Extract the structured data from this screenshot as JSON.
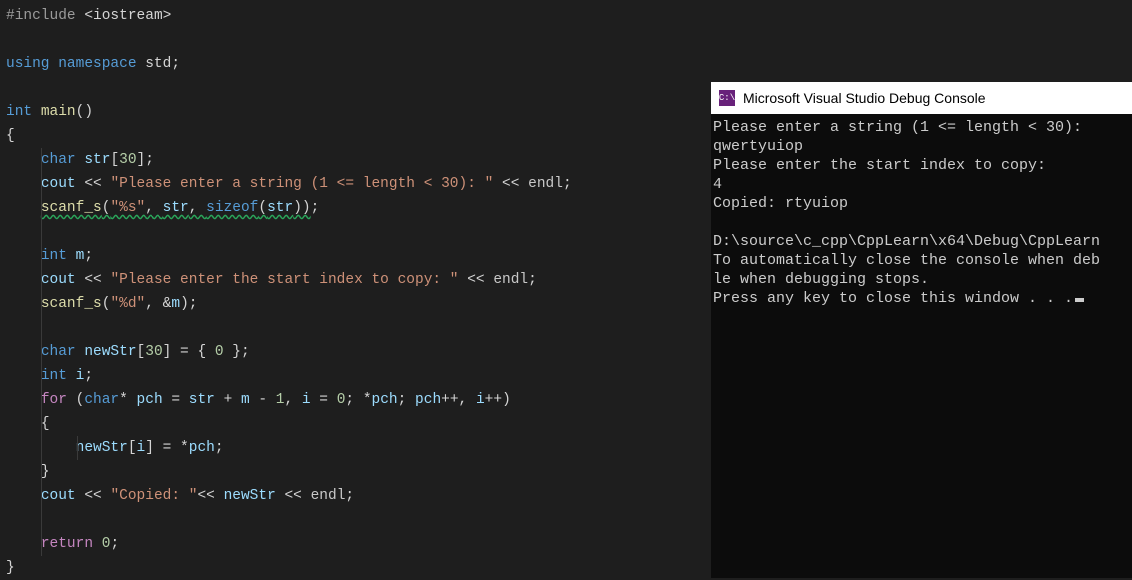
{
  "editor": {
    "lines": {
      "l1_include": "#include ",
      "l1_angleL": "<",
      "l1_hdr": "iostream",
      "l1_angleR": ">",
      "l3_using": "using ",
      "l3_namespace": "namespace ",
      "l3_std": "std",
      "l3_semi": ";",
      "l5_int": "int ",
      "l5_main": "main",
      "l5_parens": "()",
      "l6_brace": "{",
      "l7_char": "char ",
      "l7_str": "str",
      "l7_dim": "[",
      "l7_30": "30",
      "l7_end": "];",
      "l8_cout": "cout ",
      "l8_ins": "<< ",
      "l8_str": "\"Please enter a string (1 <= length < 30): \"",
      "l8_ins2": " << ",
      "l8_endl": "endl",
      "l8_semi": ";",
      "l9_scanf": "scanf_s",
      "l9_open": "(",
      "l9_fmt": "\"%s\"",
      "l9_c1": ", ",
      "l9_arg1": "str",
      "l9_c2": ", ",
      "l9_sizeof": "sizeof",
      "l9_so": "(",
      "l9_sa": "str",
      "l9_sc": "))",
      "l9_semi": ";",
      "l11_int": "int ",
      "l11_m": "m",
      "l11_semi": ";",
      "l12_cout": "cout ",
      "l12_ins": "<< ",
      "l12_str": "\"Please enter the start index to copy: \"",
      "l12_ins2": " << ",
      "l12_endl": "endl",
      "l12_semi": ";",
      "l13_scanf": "scanf_s",
      "l13_open": "(",
      "l13_fmt": "\"%d\"",
      "l13_c1": ", &",
      "l13_m": "m",
      "l13_close": ")",
      "l13_semi": ";",
      "l15_char": "char ",
      "l15_ns": "newStr",
      "l15_dim": "[",
      "l15_30": "30",
      "l15_cb": "] = { ",
      "l15_0": "0",
      "l15_ce": " };",
      "l16_int": "int ",
      "l16_i": "i",
      "l16_semi": ";",
      "l17_for": "for ",
      "l17_open": "(",
      "l17_char": "char",
      "l17_star": "* ",
      "l17_pch": "pch",
      "l17_eq": " = ",
      "l17_str": "str",
      "l17_plus": " + ",
      "l17_m": "m",
      "l17_m1": " - ",
      "l17_1": "1",
      "l17_c1": ", ",
      "l17_i": "i",
      "l17_eq0": " = ",
      "l17_0": "0",
      "l17_sc1": "; *",
      "l17_pch2": "pch",
      "l17_sc2": "; ",
      "l17_pch3": "pch",
      "l17_pp": "++, ",
      "l17_i2": "i",
      "l17_pp2": "++)",
      "l18_brace": "{",
      "l19_ns": "newStr",
      "l19_ob": "[",
      "l19_i": "i",
      "l19_cb": "] = *",
      "l19_pch": "pch",
      "l19_semi": ";",
      "l20_brace": "}",
      "l21_cout": "cout ",
      "l21_ins": "<< ",
      "l21_str": "\"Copied: \"",
      "l21_ins2": "<< ",
      "l21_ns": "newStr",
      "l21_ins3": " << ",
      "l21_endl": "endl",
      "l21_semi": ";",
      "l23_return": "return ",
      "l23_0": "0",
      "l23_semi": ";",
      "l24_brace": "}"
    }
  },
  "console": {
    "title": "Microsoft Visual Studio Debug Console",
    "icon_text": "C:\\",
    "lines": [
      "Please enter a string (1 <= length < 30):",
      "qwertyuiop",
      "Please enter the start index to copy:",
      "4",
      "Copied: rtyuiop",
      "",
      "D:\\source\\c_cpp\\CppLearn\\x64\\Debug\\CppLearn",
      "To automatically close the console when deb",
      "le when debugging stops.",
      "Press any key to close this window . . ."
    ]
  }
}
